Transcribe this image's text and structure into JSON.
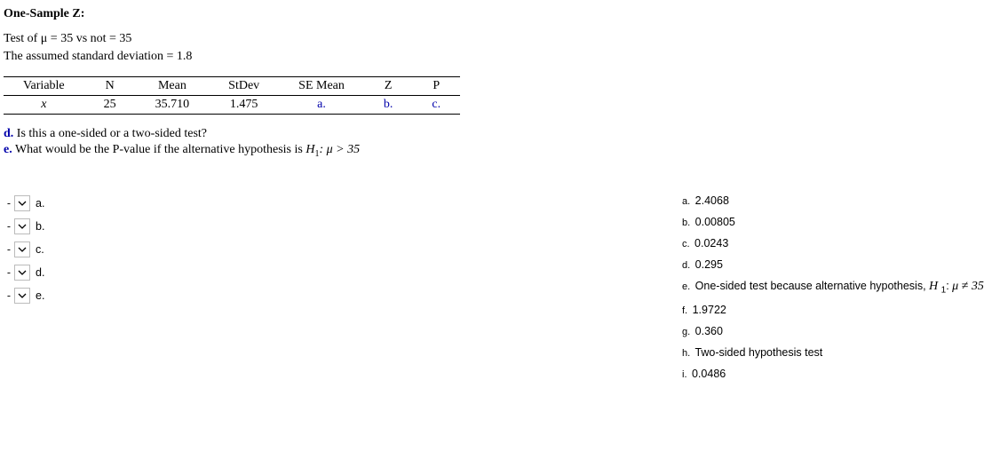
{
  "title": "One-Sample Z:",
  "test_line": "Test of μ = 35 vs not = 35",
  "assumed_sd": "The assumed standard deviation = 1.8",
  "table": {
    "headers": [
      "Variable",
      "N",
      "Mean",
      "StDev",
      "SE Mean",
      "Z",
      "P"
    ],
    "row": {
      "variable": "x",
      "n": "25",
      "mean": "35.710",
      "stdev": "1.475",
      "se_mean": "a.",
      "z": "b.",
      "p": "c."
    }
  },
  "questions": {
    "d_letter": "d.",
    "d_text": "Is this a one-sided or a two-sided test?",
    "e_letter": "e.",
    "e_text_before": "What would be the P-value if the alternative hypothesis is ",
    "e_h1": "H",
    "e_h1_sub": "1",
    "e_text_after": ": μ > 35"
  },
  "dropdowns": [
    {
      "prefix": "-",
      "label": "a."
    },
    {
      "prefix": "-",
      "label": "b."
    },
    {
      "prefix": "-",
      "label": "c."
    },
    {
      "prefix": "-",
      "label": "d."
    },
    {
      "prefix": "-",
      "label": "e."
    }
  ],
  "answers": {
    "a": {
      "letter": "a.",
      "text": "2.4068"
    },
    "b": {
      "letter": "b.",
      "text": "0.00805"
    },
    "c": {
      "letter": "c.",
      "text": "0.0243"
    },
    "d": {
      "letter": "d.",
      "text": "0.295"
    },
    "e": {
      "letter": "e.",
      "text_before": "One-sided test because alternative hypothesis, ",
      "h": "H",
      "sub": "1",
      "colon": ": ",
      "mu": "μ ≠ 35"
    },
    "f": {
      "letter": "f.",
      "text": "1.9722"
    },
    "g": {
      "letter": "g.",
      "text": "0.360"
    },
    "h": {
      "letter": "h.",
      "text": "Two-sided hypothesis test"
    },
    "i": {
      "letter": "i.",
      "text": "0.0486"
    }
  }
}
